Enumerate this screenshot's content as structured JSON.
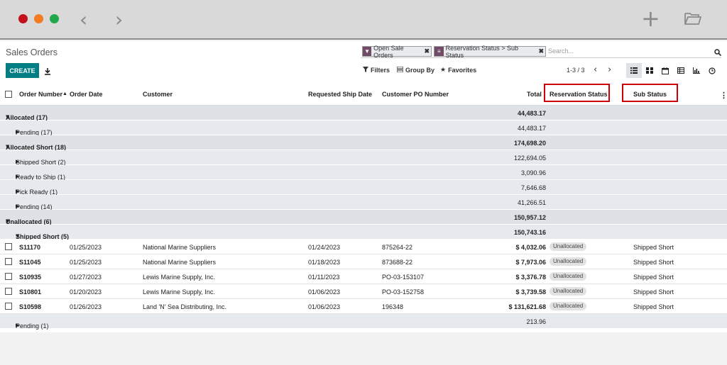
{
  "colors": {
    "accent": "#017e84",
    "brand": "#714b67",
    "highlight": "#d0000b",
    "close_dot": "#c4101a",
    "min_dot": "#f47b20",
    "max_dot": "#22a84a"
  },
  "window": {
    "back_icon": "chevron-left-icon",
    "forward_icon": "chevron-right-icon",
    "new_icon": "plus-icon",
    "open_icon": "folder-icon"
  },
  "header": {
    "title": "Sales Orders"
  },
  "search": {
    "facets": [
      {
        "icon": "filter-icon",
        "label": "Open Sale Orders"
      },
      {
        "icon": "group-by-icon",
        "label": "Reservation Status > Sub Status"
      }
    ],
    "placeholder": "Search..."
  },
  "toolbar": {
    "create_label": "CREATE",
    "filters_label": "Filters",
    "group_by_label": "Group By",
    "favorites_label": "Favorites",
    "pager": "1-3 / 3"
  },
  "columns": {
    "order_number": "Order Number",
    "order_date": "Order Date",
    "customer": "Customer",
    "requested_ship_date": "Requested Ship Date",
    "customer_po": "Customer PO Number",
    "total": "Total",
    "reservation_status": "Reservation Status",
    "sub_status": "Sub Status"
  },
  "groups": {
    "g1": {
      "label": "Allocated (17)",
      "total": "44,483.17"
    },
    "g1a": {
      "label": "Pending (17)",
      "total": "44,483.17"
    },
    "g2": {
      "label": "Allocated Short (18)",
      "total": "174,698.20"
    },
    "g2a": {
      "label": "Shipped Short (2)",
      "total": "122,694.05"
    },
    "g2b": {
      "label": "Ready to Ship (1)",
      "total": "3,090.96"
    },
    "g2c": {
      "label": "Pick Ready (1)",
      "total": "7,646.68"
    },
    "g2d": {
      "label": "Pending (14)",
      "total": "41,266.51"
    },
    "g3": {
      "label": "Unallocated (6)",
      "total": "150,957.12"
    },
    "g3a": {
      "label": "Shipped Short (5)",
      "total": "150,743.16"
    },
    "g3b": {
      "label": "Pending (1)",
      "total": "213.96"
    }
  },
  "records": [
    {
      "order": "S11170",
      "date": "01/25/2023",
      "customer": "National Marine Suppliers",
      "ship": "01/24/2023",
      "po": "875264-22",
      "total": "$ 4,032.06",
      "status": "Unallocated",
      "sub": "Shipped Short"
    },
    {
      "order": "S11045",
      "date": "01/25/2023",
      "customer": "National Marine Suppliers",
      "ship": "01/18/2023",
      "po": "873688-22",
      "total": "$ 7,973.06",
      "status": "Unallocated",
      "sub": "Shipped Short"
    },
    {
      "order": "S10935",
      "date": "01/27/2023",
      "customer": "Lewis Marine Supply, Inc.",
      "ship": "01/11/2023",
      "po": "PO-03-153107",
      "total": "$ 3,376.78",
      "status": "Unallocated",
      "sub": "Shipped Short"
    },
    {
      "order": "S10801",
      "date": "01/20/2023",
      "customer": "Lewis Marine Supply, Inc.",
      "ship": "01/06/2023",
      "po": "PO-03-152758",
      "total": "$ 3,739.58",
      "status": "Unallocated",
      "sub": "Shipped Short"
    },
    {
      "order": "S10598",
      "date": "01/26/2023",
      "customer": "Land 'N' Sea Distributing, Inc.",
      "ship": "01/06/2023",
      "po": "196348",
      "total": "$ 131,621.68",
      "status": "Unallocated",
      "sub": "Shipped Short"
    }
  ]
}
